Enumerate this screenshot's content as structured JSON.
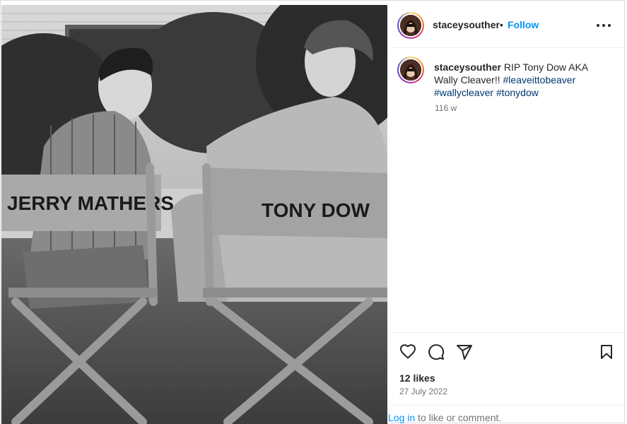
{
  "post": {
    "photo": {
      "chair_left_text": "JERRY MATHERS",
      "chair_right_text": "TONY DOW"
    },
    "header": {
      "username": "staceysouther",
      "separator": "•",
      "follow_label": "Follow",
      "more_icon": "more-horizontal-icon"
    },
    "caption": {
      "username": "staceysouther",
      "text": " RIP Tony Dow AKA Wally Cleaver!! ",
      "hashtags": [
        "#leaveittobeaver",
        "#wallycleaver",
        "#tonydow"
      ],
      "time_ago": "116 w"
    },
    "actions": {
      "like_icon": "heart-icon",
      "comment_icon": "comment-icon",
      "share_icon": "send-icon",
      "save_icon": "bookmark-icon"
    },
    "likes": "12 likes",
    "date": "27 July 2022",
    "login": {
      "link_label": "Log in",
      "suffix": " to like or comment."
    }
  }
}
